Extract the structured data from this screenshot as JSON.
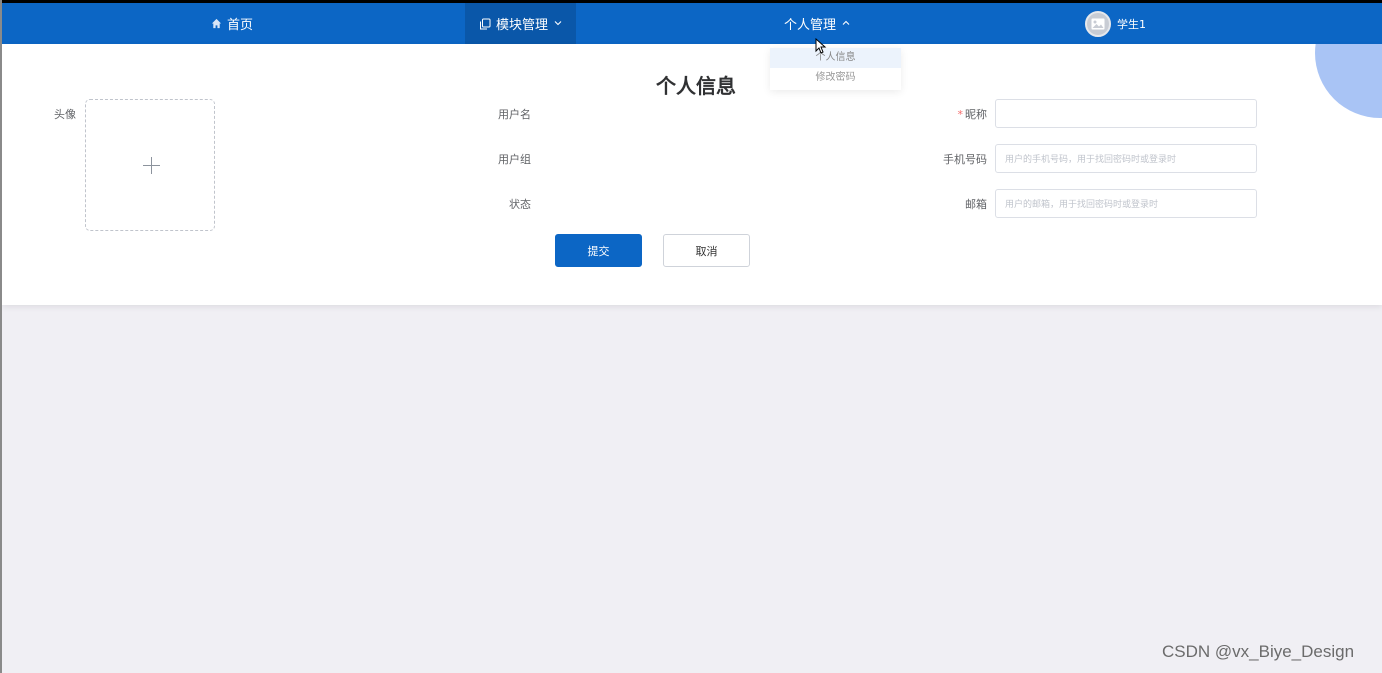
{
  "navbar": {
    "items": [
      {
        "label": "首页",
        "icon": "home-icon"
      },
      {
        "label": "模块管理",
        "icon": "copy-icon",
        "chevron": "chevron-down-icon"
      },
      {
        "label": "个人管理",
        "chevron": "chevron-up-icon"
      }
    ],
    "user": {
      "name": "学生1",
      "avatar_icon": "image-placeholder-icon"
    }
  },
  "dropdown": {
    "items": [
      "个人信息",
      "修改密码"
    ]
  },
  "form": {
    "title": "个人信息",
    "avatar_label": "头像",
    "upload_icon": "plus-icon",
    "username_label": "用户名",
    "usergroup_label": "用户组",
    "status_label": "状态",
    "nickname_required_mark": "*",
    "nickname_label": "昵称",
    "nickname_value": "",
    "phone_label": "手机号码",
    "phone_placeholder": "用户的手机号码，用于找回密码时或登录时",
    "email_label": "邮箱",
    "email_placeholder": "用户的邮箱，用于找回密码时或登录时",
    "submit_label": "提交",
    "cancel_label": "取消"
  },
  "colors": {
    "primary": "#0c66c5",
    "navbar_active": "#0a57a9",
    "decor_circle": "#a9c4f5",
    "page_bg": "#f0eff4",
    "required": "#f56c6c"
  },
  "watermark": "CSDN @vx_Biye_Design"
}
